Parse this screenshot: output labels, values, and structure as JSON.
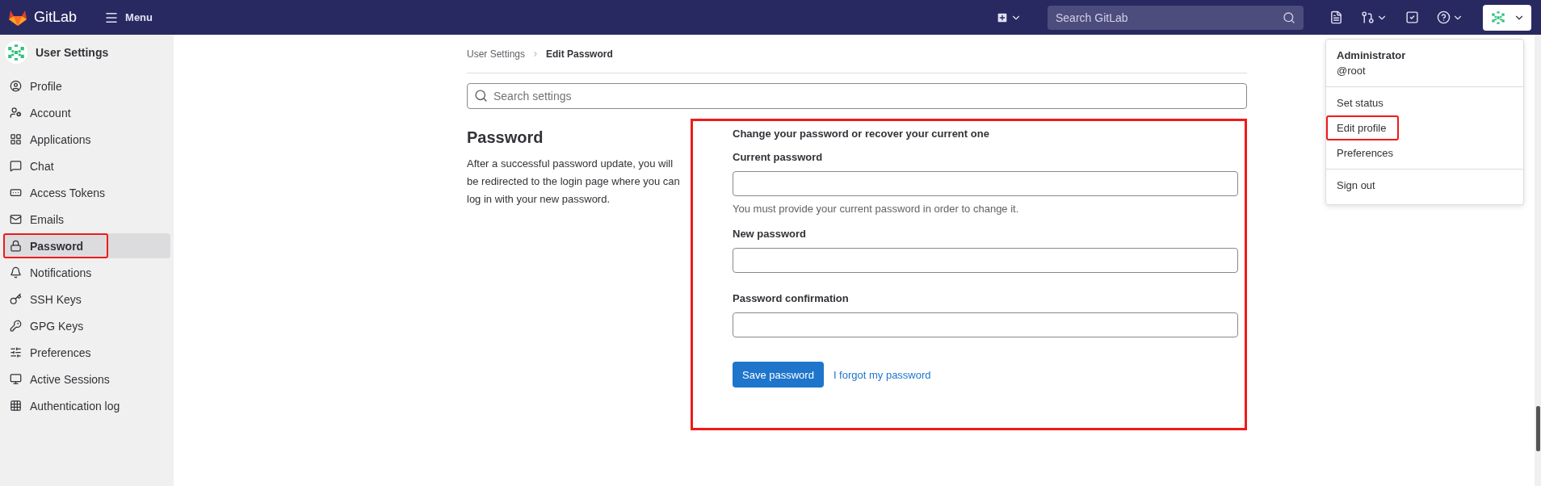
{
  "topbar": {
    "brand": "GitLab",
    "menu": "Menu",
    "search": {
      "placeholder": "Search GitLab"
    }
  },
  "sidebar": {
    "title": "User Settings",
    "items": [
      {
        "label": "Profile",
        "selected": false,
        "highlighted": false
      },
      {
        "label": "Account",
        "selected": false,
        "highlighted": false
      },
      {
        "label": "Applications",
        "selected": false,
        "highlighted": false
      },
      {
        "label": "Chat",
        "selected": false,
        "highlighted": false
      },
      {
        "label": "Access Tokens",
        "selected": false,
        "highlighted": false
      },
      {
        "label": "Emails",
        "selected": false,
        "highlighted": false
      },
      {
        "label": "Password",
        "selected": true,
        "highlighted": true
      },
      {
        "label": "Notifications",
        "selected": false,
        "highlighted": false
      },
      {
        "label": "SSH Keys",
        "selected": false,
        "highlighted": false
      },
      {
        "label": "GPG Keys",
        "selected": false,
        "highlighted": false
      },
      {
        "label": "Preferences",
        "selected": false,
        "highlighted": false
      },
      {
        "label": "Active Sessions",
        "selected": false,
        "highlighted": false
      },
      {
        "label": "Authentication log",
        "selected": false,
        "highlighted": false
      }
    ]
  },
  "breadcrumb": [
    "User Settings",
    "Edit Password"
  ],
  "settings_search": {
    "placeholder": "Search settings"
  },
  "section": {
    "title": "Password",
    "description": "After a successful password update, you will be redirected to the login page where you can log in with your new password."
  },
  "form": {
    "highlighted": true,
    "heading": "Change your password or recover your current one",
    "fields": [
      {
        "label": "Current password",
        "help": "You must provide your current password in order to change it."
      },
      {
        "label": "New password"
      },
      {
        "label": "Password confirmation"
      }
    ],
    "submit": "Save password",
    "link": "I forgot my password"
  },
  "user_menu": {
    "name": "Administrator",
    "username": "@root",
    "sections": [
      {
        "items": [
          {
            "label": "Set status",
            "highlighted": false
          },
          {
            "label": "Edit profile",
            "highlighted": true
          },
          {
            "label": "Preferences",
            "highlighted": false
          }
        ]
      },
      {
        "items": [
          {
            "label": "Sign out",
            "highlighted": false
          }
        ]
      }
    ]
  }
}
